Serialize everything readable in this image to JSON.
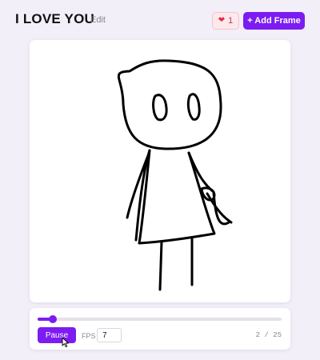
{
  "header": {
    "title": "I LOVE YOU",
    "edit_label": "Edit",
    "like_count": "1",
    "add_frame_label": "+ Add Frame"
  },
  "player": {
    "pause_label": "Pause",
    "fps_label": "FPS",
    "fps_value": "7",
    "frame_counter": "2 / 25",
    "current_frame": 2,
    "total_frames": 25
  },
  "colors": {
    "accent": "#7c1cf1",
    "background": "#f2eff8",
    "like_bg": "#fde8ec",
    "heart": "#e0304e"
  },
  "icons": {
    "like": "heart-icon",
    "cursor": "mouse-cursor-icon"
  }
}
